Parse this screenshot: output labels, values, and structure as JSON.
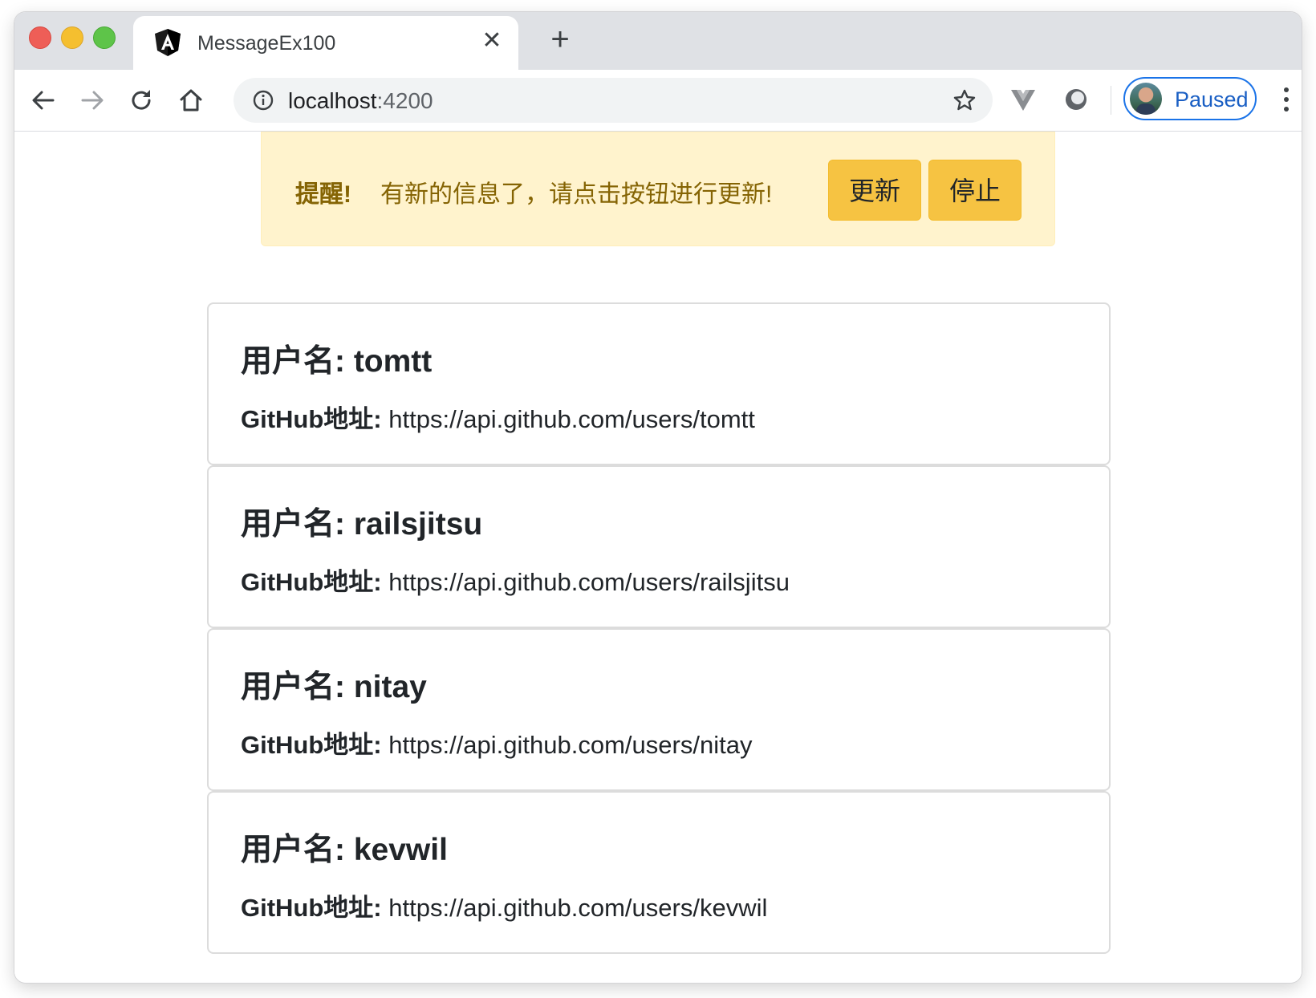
{
  "browser": {
    "tab_title": "MessageEx100",
    "tab_close_glyph": "✕",
    "new_tab_glyph": "+",
    "url_host": "localhost",
    "url_port": ":4200",
    "profile_label": "Paused",
    "icons": [
      "back-icon",
      "forward-icon",
      "reload-icon",
      "home-icon",
      "info-icon",
      "star-icon",
      "vue-devtools-icon",
      "extension-icon",
      "menu-icon"
    ]
  },
  "alert": {
    "strong": "提醒!",
    "text": "有新的信息了，请点击按钮进行更新!",
    "update_label": "更新",
    "stop_label": "停止",
    "bg_color": "#fff3cd",
    "button_color": "#f6c342"
  },
  "users": [
    {
      "title": "用户名: tomtt",
      "link_label": "GitHub地址:",
      "link": "https://api.github.com/users/tomtt"
    },
    {
      "title": "用户名: railsjitsu",
      "link_label": "GitHub地址:",
      "link": "https://api.github.com/users/railsjitsu"
    },
    {
      "title": "用户名: nitay",
      "link_label": "GitHub地址:",
      "link": "https://api.github.com/users/nitay"
    },
    {
      "title": "用户名: kevwil",
      "link_label": "GitHub地址:",
      "link": "https://api.github.com/users/kevwil"
    }
  ]
}
